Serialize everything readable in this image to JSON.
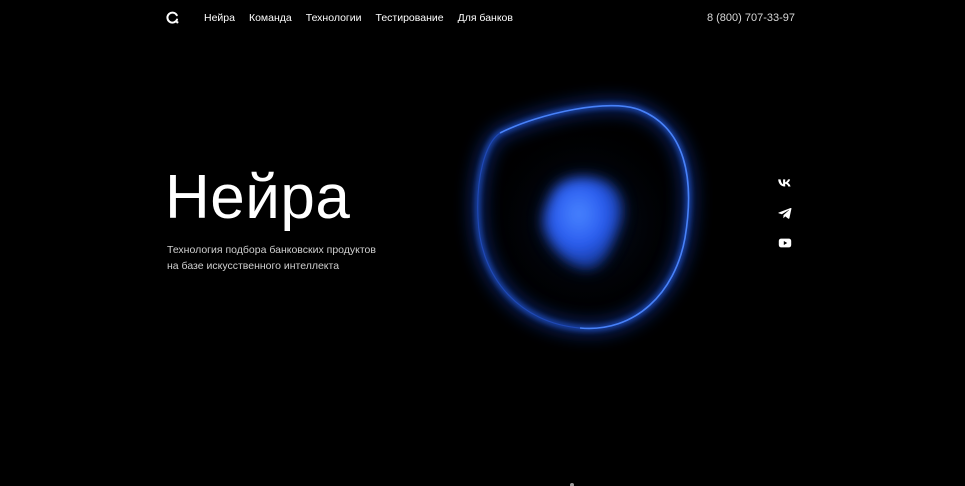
{
  "header": {
    "logo_icon": "loader-circle-icon",
    "nav": [
      {
        "label": "Нейра"
      },
      {
        "label": "Команда"
      },
      {
        "label": "Технологии"
      },
      {
        "label": "Тестирование"
      },
      {
        "label": "Для банков"
      }
    ],
    "phone": "8 (800) 707-33-97"
  },
  "hero": {
    "title": "Нейра",
    "subtitle_line1": "Технология подбора банковских продуктов",
    "subtitle_line2": "на базе искусственного интеллекта"
  },
  "social": [
    {
      "icon": "vk-icon"
    },
    {
      "icon": "telegram-icon"
    },
    {
      "icon": "youtube-icon"
    }
  ],
  "colors": {
    "background": "#000000",
    "accent_blue": "#2f6bff",
    "text": "#ffffff"
  }
}
